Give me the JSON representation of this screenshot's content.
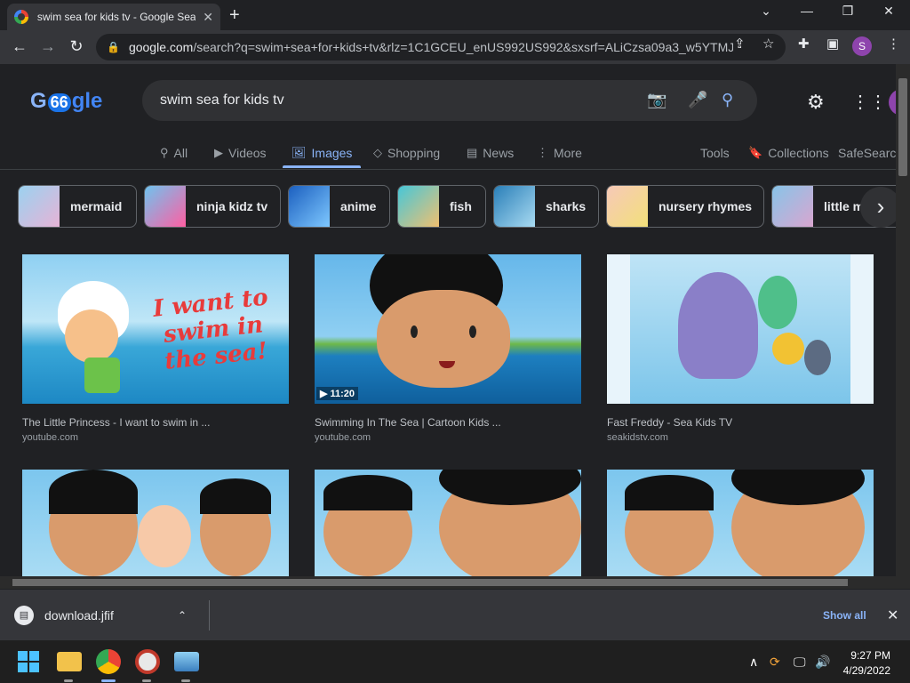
{
  "browser": {
    "tab_title": "swim sea for kids tv - Google Sea",
    "tab_close": "✕",
    "new_tab": "+",
    "window_controls": {
      "dropdown": "⌄",
      "minimize": "—",
      "restore": "❐",
      "close": "✕"
    },
    "url_host": "google.com",
    "url_path": "/search?q=swim+sea+for+kids+tv&rlz=1C1GCEU_enUS992US992&sxsrf=ALiCzsa09a3_w5YTMJ...",
    "profile_initial": "S"
  },
  "search": {
    "logo_text": "Google",
    "logo_badge": "66",
    "query": "swim sea for kids tv"
  },
  "tabs": [
    {
      "label": "All",
      "icon": "search-icon"
    },
    {
      "label": "Videos",
      "icon": "video-icon"
    },
    {
      "label": "Images",
      "icon": "image-icon",
      "active": true
    },
    {
      "label": "Shopping",
      "icon": "tag-icon"
    },
    {
      "label": "News",
      "icon": "newspaper-icon"
    },
    {
      "label": "More",
      "icon": "more-vert-icon"
    }
  ],
  "tools": {
    "tools_label": "Tools",
    "collections_label": "Collections",
    "safesearch_label": "SafeSearch"
  },
  "chips": [
    {
      "label": "mermaid",
      "color": "#7ab8e0"
    },
    {
      "label": "ninja kidz tv",
      "color": "#4aa3d8"
    },
    {
      "label": "anime",
      "color": "#1f6fd1"
    },
    {
      "label": "fish",
      "color": "#3bb3c7"
    },
    {
      "label": "sharks",
      "color": "#2f8fc4"
    },
    {
      "label": "nursery rhymes",
      "color": "#f2b3a0"
    },
    {
      "label": "little m",
      "color": "#88c4e8"
    }
  ],
  "results": [
    {
      "title": "The Little Princess - I want to swim in ...",
      "source": "youtube.com",
      "duration": "",
      "image_text": "I want to swim in the sea!"
    },
    {
      "title": "Swimming In The Sea | Cartoon Kids ...",
      "source": "youtube.com",
      "duration": "▶ 11:20",
      "image_text": ""
    },
    {
      "title": "Fast Freddy - Sea Kids TV",
      "source": "seakidstv.com",
      "duration": "",
      "image_text": ""
    }
  ],
  "downloads": {
    "file_name": "download.jfif",
    "show_all": "Show all"
  },
  "taskbar": {
    "time": "9:27 PM",
    "date": "4/29/2022"
  },
  "colors": {
    "accent": "#8ab4f8",
    "background": "#202124",
    "toolbar": "#35363a"
  }
}
